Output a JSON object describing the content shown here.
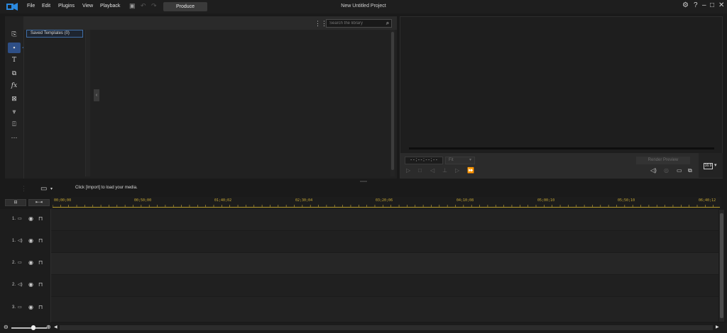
{
  "menu": {
    "items": [
      "File",
      "Edit",
      "Plugins",
      "View",
      "Playback"
    ],
    "produce_label": "Produce",
    "project_title": "New Untitled Project",
    "window_controls": [
      "settings-icon",
      "help-icon",
      "minimize-icon",
      "maximize-icon",
      "close-icon"
    ]
  },
  "library": {
    "search_placeholder": "Search the library",
    "saved_templates_label": "Saved Templates  (0)"
  },
  "preview": {
    "timecode": "- - ; - - ; - - ; - -",
    "fit_label": "Fit",
    "render_label": "Render Preview",
    "aspect_label": "16:9"
  },
  "timeline": {
    "import_hint": "Click [Import] to load your media.",
    "ruler_ticks": [
      "00;00;00",
      "00;50;00",
      "01;40;02",
      "02;30;04",
      "03;20;06",
      "04;10;08",
      "05;00;10",
      "05;50;10",
      "06;40;12"
    ],
    "tracks": [
      {
        "label": "1.",
        "type": "video"
      },
      {
        "label": "1.",
        "type": "audio"
      },
      {
        "label": "2.",
        "type": "video"
      },
      {
        "label": "2.",
        "type": "audio"
      },
      {
        "label": "3.",
        "type": "video"
      }
    ]
  },
  "colors": {
    "accent": "#2e4f86",
    "ruler": "#c8a834",
    "background": "#1a1a1a"
  }
}
